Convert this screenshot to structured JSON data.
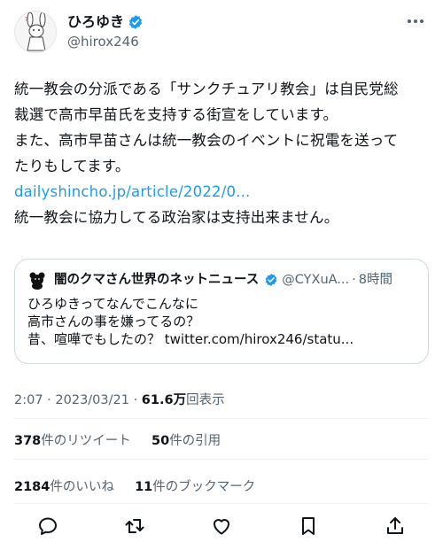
{
  "user": {
    "display_name": "ひろゆき",
    "handle": "@hirox246",
    "verified_color": "#1d9bf0"
  },
  "tweet": {
    "lines": [
      "統一教会の分派である「サンクチュアリ教会」は自民党総",
      "裁選で高市早苗氏を支持する街宣をしています。",
      "また、高市早苗さんは統一教会のイベントに祝電を送って",
      "たりもしてます。"
    ],
    "link": "dailyshincho.jp/article/2022/0...",
    "last_line": "統一教会に協力してる政治家は支持出来ません。"
  },
  "quote": {
    "display_name": "闇のクマさん世界のネットニュース",
    "handle": "@CYXuA...",
    "dot": "·",
    "time": "8時間",
    "lines": [
      "ひろゆきってなんでこんなに",
      "高市さんの事を嫌ってるの？",
      "昔、喧嘩でもしたの？ twitter.com/hirox246/statu..."
    ]
  },
  "meta": {
    "time": "2:07",
    "date": "2023/03/21",
    "views_count": "61.6万",
    "views_label": "回表示"
  },
  "stats": {
    "retweets_count": "378",
    "retweets_label": "件のリツイート",
    "quotes_count": "50",
    "quotes_label": "件の引用",
    "likes_count": "2184",
    "likes_label": "件のいいね",
    "bookmarks_count": "11",
    "bookmarks_label": "件のブックマーク"
  },
  "icons": {
    "more": "more-icon",
    "reply": "reply-icon",
    "retweet": "retweet-icon",
    "like": "heart-icon",
    "bookmark": "bookmark-icon",
    "share": "share-icon"
  }
}
